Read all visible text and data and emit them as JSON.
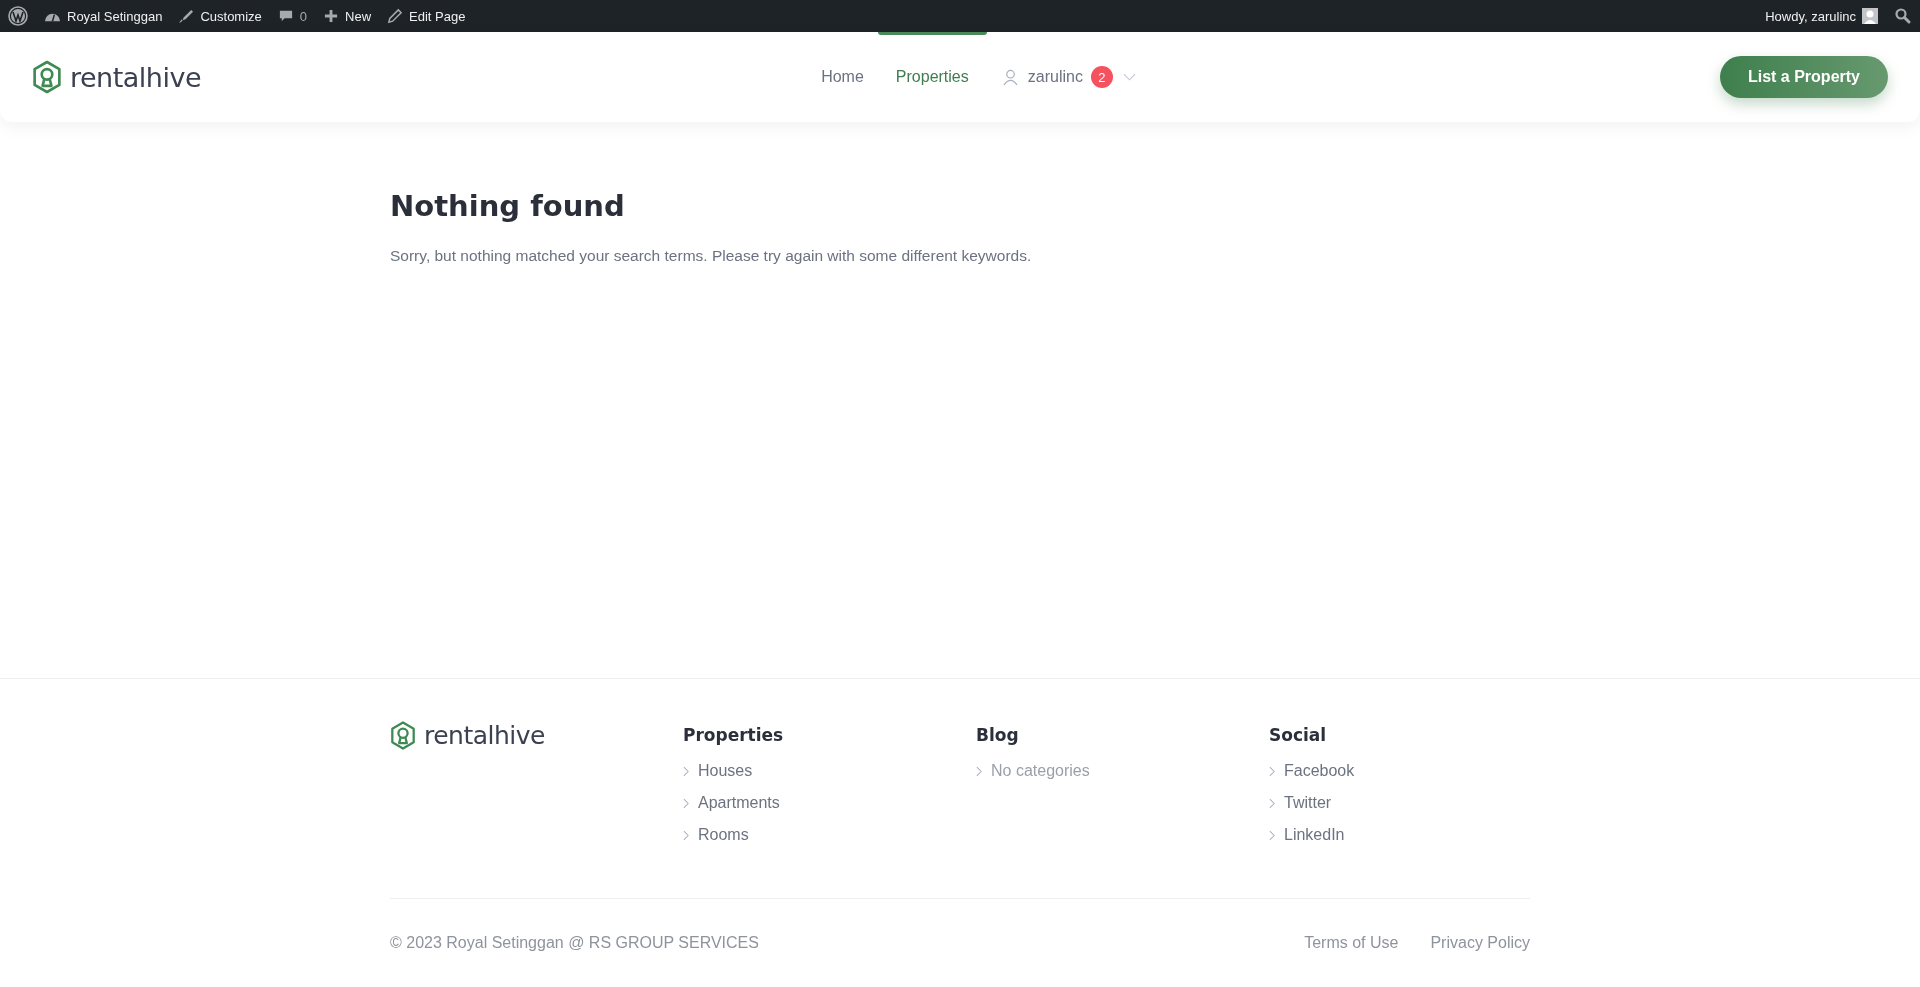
{
  "admin_bar": {
    "site": "Royal Setinggan",
    "items": [
      {
        "kind": "customize",
        "label": "Customize"
      },
      {
        "kind": "comments",
        "label": "0"
      },
      {
        "kind": "new",
        "label": "New"
      },
      {
        "kind": "edit",
        "label": "Edit Page"
      }
    ],
    "greeting": "Howdy, zarulinc"
  },
  "header": {
    "logo": "rentalhive",
    "nav": [
      {
        "label": "Home",
        "selected": false
      },
      {
        "label": "Properties",
        "selected": true
      }
    ],
    "user": {
      "name": "zarulinc",
      "badge": "2"
    },
    "button": "List a Property"
  },
  "content": {
    "title": "Nothing found",
    "message": "Sorry, but nothing matched your search terms. Please try again with some different keywords."
  },
  "footer": {
    "logo": "rentalhive",
    "columns": [
      {
        "heading": "Properties",
        "links": [
          {
            "label": "Houses",
            "muted": false
          },
          {
            "label": "Apartments",
            "muted": false
          },
          {
            "label": "Rooms",
            "muted": false
          }
        ]
      },
      {
        "heading": "Blog",
        "links": [
          {
            "label": "No categories",
            "muted": true
          }
        ]
      },
      {
        "heading": "Social",
        "links": [
          {
            "label": "Facebook",
            "muted": false
          },
          {
            "label": "Twitter",
            "muted": false
          },
          {
            "label": "LinkedIn",
            "muted": false
          }
        ]
      }
    ],
    "copyright": "© 2023 Royal Setinggan @ RS GROUP SERVICES",
    "legal_links": [
      "Terms of Use",
      "Privacy Policy"
    ]
  }
}
